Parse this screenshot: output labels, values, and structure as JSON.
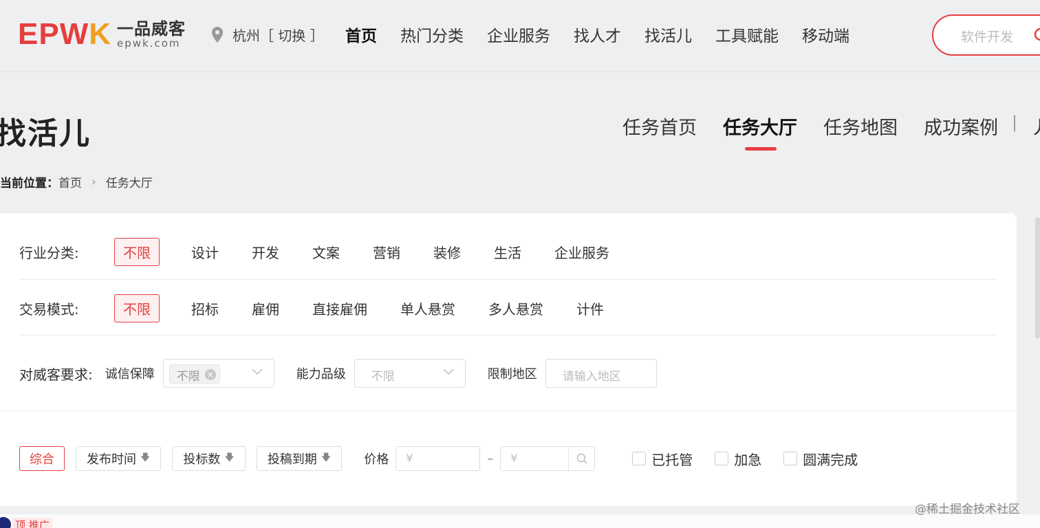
{
  "header": {
    "logo_mark": "EPWK",
    "logo_cn": "一品威客",
    "logo_en": "epwk.com",
    "location": "杭州［ 切换 ］",
    "nav": [
      "首页",
      "热门分类",
      "企业服务",
      "找人才",
      "找活儿",
      "工具赋能",
      "移动端"
    ],
    "active_nav": "首页",
    "search_placeholder": "软件开发"
  },
  "page": {
    "title": "找活儿",
    "subnav": [
      "任务首页",
      "任务大厅",
      "任务地图",
      "成功案例"
    ],
    "subnav_more": "丿",
    "active_subnav": "任务大厅",
    "breadcrumb_label": "当前位置：",
    "breadcrumb": [
      "首页",
      "任务大厅"
    ]
  },
  "filters": {
    "industry_label": "行业分类:",
    "industry_options": [
      "不限",
      "设计",
      "开发",
      "文案",
      "营销",
      "装修",
      "生活",
      "企业服务"
    ],
    "mode_label": "交易模式:",
    "mode_options": [
      "不限",
      "招标",
      "雇佣",
      "直接雇佣",
      "单人悬赏",
      "多人悬赏",
      "计件"
    ],
    "requirements_label": "对威客要求:",
    "credit_label": "诚信保障",
    "credit_value": "不限",
    "level_label": "能力品级",
    "level_value": "不限",
    "region_label": "限制地区",
    "region_placeholder": "请输入地区"
  },
  "sort": {
    "default": "综合",
    "publish_time": "发布时间",
    "bids": "投标数",
    "deadline": "投稿到期",
    "price_label": "价格",
    "price_min_placeholder": "¥",
    "price_max_placeholder": "¥",
    "dash": "–",
    "checks": [
      "已托管",
      "加急",
      "圆满完成"
    ]
  },
  "footer": {
    "promo": "顶 推广",
    "watermark": "@稀土掘金技术社区"
  },
  "colors": {
    "accent": "#e53e3e",
    "logo_orange": "#f0a020",
    "background": "#eeeff1"
  }
}
